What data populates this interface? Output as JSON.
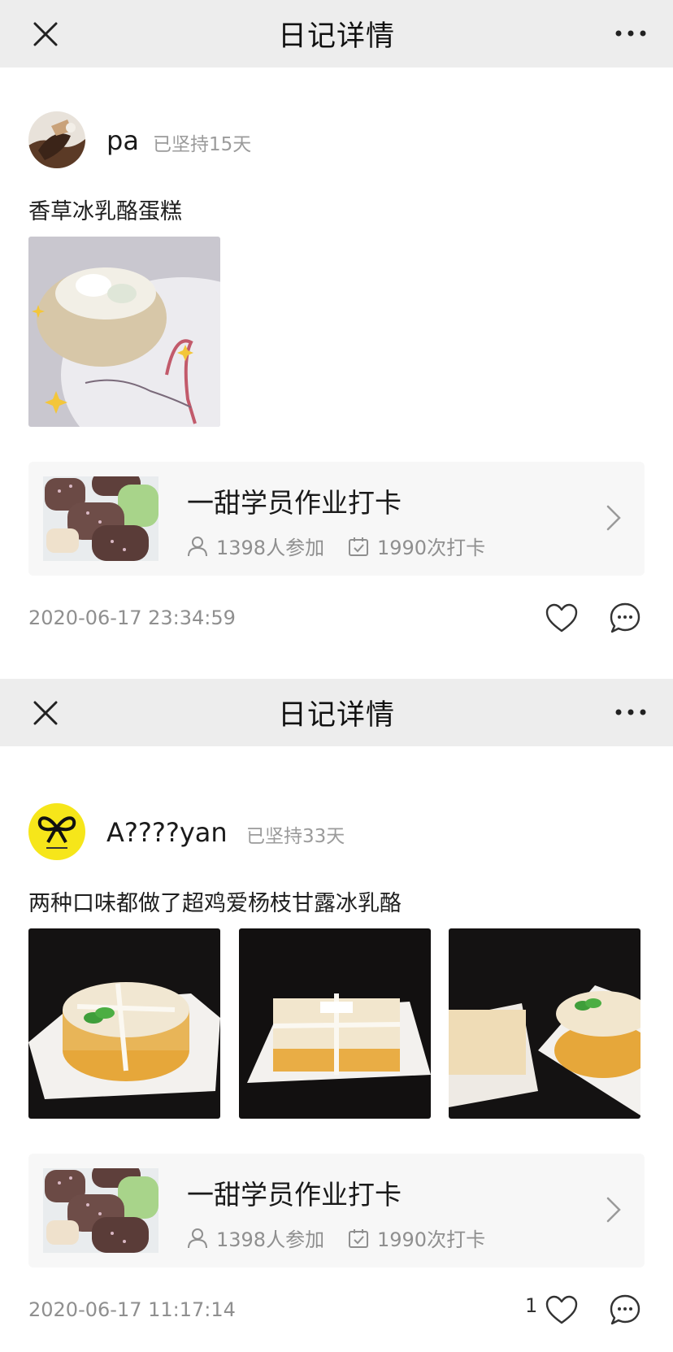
{
  "posts": [
    {
      "nav": {
        "title": "日记详情"
      },
      "user": {
        "name": "pa",
        "streak": "已坚持15天"
      },
      "text": "香草冰乳酪蛋糕",
      "group": {
        "name": "一甜学员作业打卡",
        "members": "1398人参加",
        "checkins": "1990次打卡"
      },
      "timestamp": "2020-06-17 23:34:59",
      "like_count": ""
    },
    {
      "nav": {
        "title": "日记详情"
      },
      "user": {
        "name": "A????yan",
        "streak": "已坚持33天"
      },
      "text": "两种口味都做了超鸡爱杨枝甘露冰乳酪",
      "group": {
        "name": "一甜学员作业打卡",
        "members": "1398人参加",
        "checkins": "1990次打卡"
      },
      "timestamp": "2020-06-17 11:17:14",
      "like_count": "1"
    }
  ],
  "icons": {
    "close": "close-icon",
    "more": "more-icon",
    "person": "person-icon",
    "calendar": "calendar-check-icon",
    "chevron": "chevron-right-icon",
    "heart": "heart-icon",
    "comment": "comment-icon"
  },
  "colors": {
    "navbar_bg": "#ededed",
    "card_bg": "#f7f7f7",
    "muted_text": "#8f8f8f",
    "separator": "#ededed"
  }
}
